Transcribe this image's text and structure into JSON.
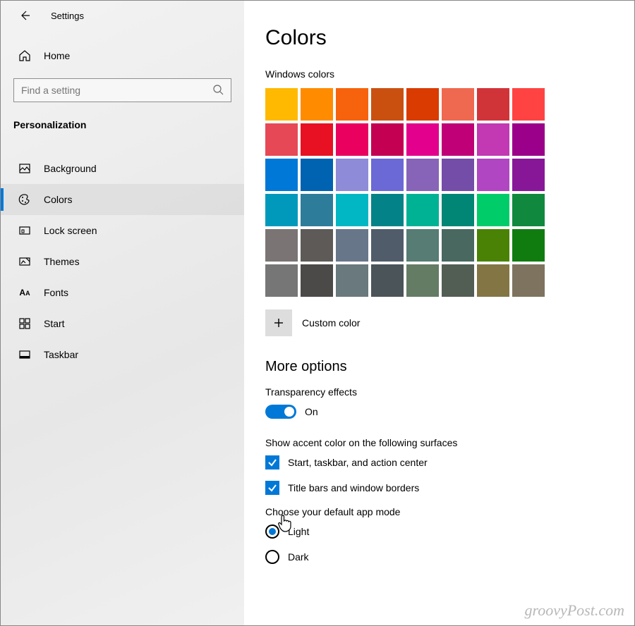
{
  "topbar": {
    "title": "Settings"
  },
  "sidebar": {
    "home": "Home",
    "search_placeholder": "Find a setting",
    "category": "Personalization",
    "items": [
      {
        "label": "Background"
      },
      {
        "label": "Colors",
        "active": true
      },
      {
        "label": "Lock screen"
      },
      {
        "label": "Themes"
      },
      {
        "label": "Fonts"
      },
      {
        "label": "Start"
      },
      {
        "label": "Taskbar"
      }
    ]
  },
  "main": {
    "title": "Colors",
    "windows_colors_label": "Windows colors",
    "swatches": [
      [
        "#FFB900",
        "#FF8C00",
        "#F7630C",
        "#CA5010",
        "#DA3B01",
        "#EF6950",
        "#D13438",
        "#FF4343"
      ],
      [
        "#E74856",
        "#E81123",
        "#EA005E",
        "#C30052",
        "#E3008C",
        "#BF0077",
        "#C239B3",
        "#9A0089"
      ],
      [
        "#0078D7",
        "#0063B1",
        "#8E8CD8",
        "#6B69D6",
        "#8764B8",
        "#744DA9",
        "#B146C2",
        "#881798"
      ],
      [
        "#0099BC",
        "#2D7D9A",
        "#00B7C3",
        "#038387",
        "#00B294",
        "#018574",
        "#00CC6A",
        "#10893E"
      ],
      [
        "#7A7574",
        "#5D5A58",
        "#68768A",
        "#515C6B",
        "#567C73",
        "#486860",
        "#498205",
        "#107C10"
      ],
      [
        "#767676",
        "#4C4A48",
        "#69797E",
        "#4A5459",
        "#647C64",
        "#525E54",
        "#847545",
        "#7E735F"
      ]
    ],
    "custom_color_label": "Custom color",
    "more_options_label": "More options",
    "transparency_label": "Transparency effects",
    "transparency_state": "On",
    "accent_surfaces_label": "Show accent color on the following surfaces",
    "check_start": "Start, taskbar, and action center",
    "check_titlebars": "Title bars and window borders",
    "default_mode_label": "Choose your default app mode",
    "radio_light": "Light",
    "radio_dark": "Dark"
  },
  "watermark": "groovyPost.com"
}
